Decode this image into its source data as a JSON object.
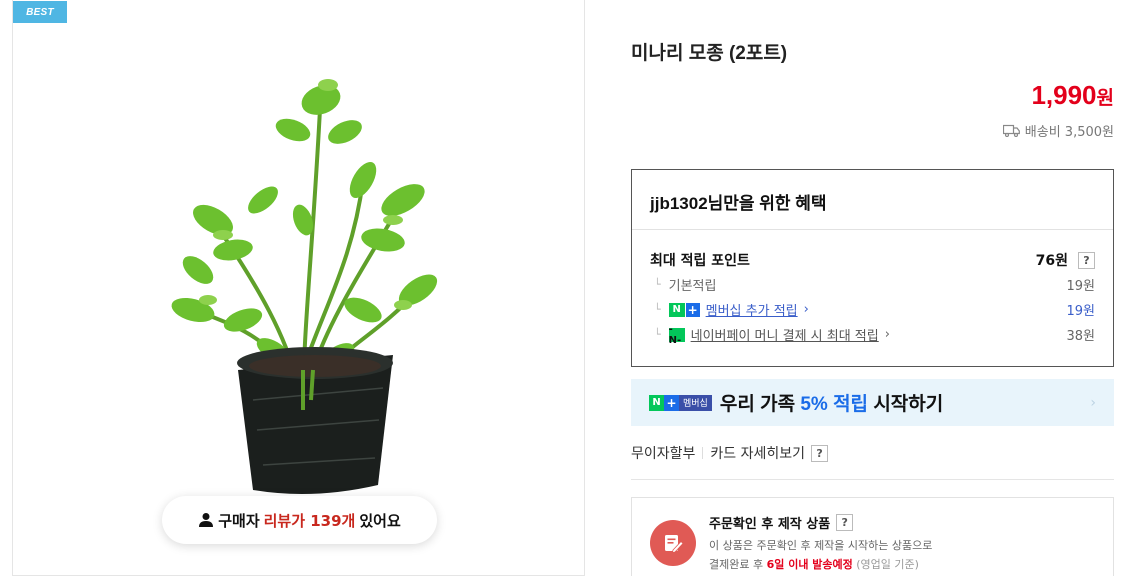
{
  "badge": "BEST",
  "review_pill": {
    "prefix": "구매자",
    "highlight": "리뷰가 139개",
    "suffix": "있어요"
  },
  "product": {
    "title": "미나리 모종 (2포트)",
    "price": "1,990",
    "price_unit": "원",
    "shipping": "배송비 3,500원"
  },
  "benefits": {
    "title": "jjb1302님만을 위한 혜택",
    "max_point_label": "최대 적립 포인트",
    "max_point_value": "76원",
    "basic_label": "기본적립",
    "basic_value": "19원",
    "membership_label": "멤버십 추가 적립",
    "membership_value": "19원",
    "npay_label": "네이버페이 머니 결제 시 최대 적립",
    "npay_value": "38원"
  },
  "membership_banner": {
    "badge_n": "N",
    "badge_plus": "+",
    "badge_text": "멤버십",
    "text_before": "우리 가족",
    "highlight": "5% 적립",
    "text_after": "시작하기"
  },
  "installment": {
    "label": "무이자할부",
    "card_label": "카드 자세히보기",
    "help": "?"
  },
  "notice": {
    "title": "주문확인 후 제작 상품",
    "line1": "이 상품은 주문확인 후 제작을 시작하는 상품으로",
    "line2_before": "결제완료 후",
    "line2_highlight": "6일 이내 발송예정",
    "line2_after": "(영업일 기준)"
  },
  "colors": {
    "price": "#e3001b",
    "best_badge": "#4fb6e3",
    "naver_green": "#03c75a",
    "naver_blue": "#1a6ce8",
    "notice_icon": "#e05a55"
  },
  "icons": [
    "user-icon",
    "truck-icon",
    "chevron-right-icon",
    "help-icon",
    "edit-document-icon"
  ]
}
